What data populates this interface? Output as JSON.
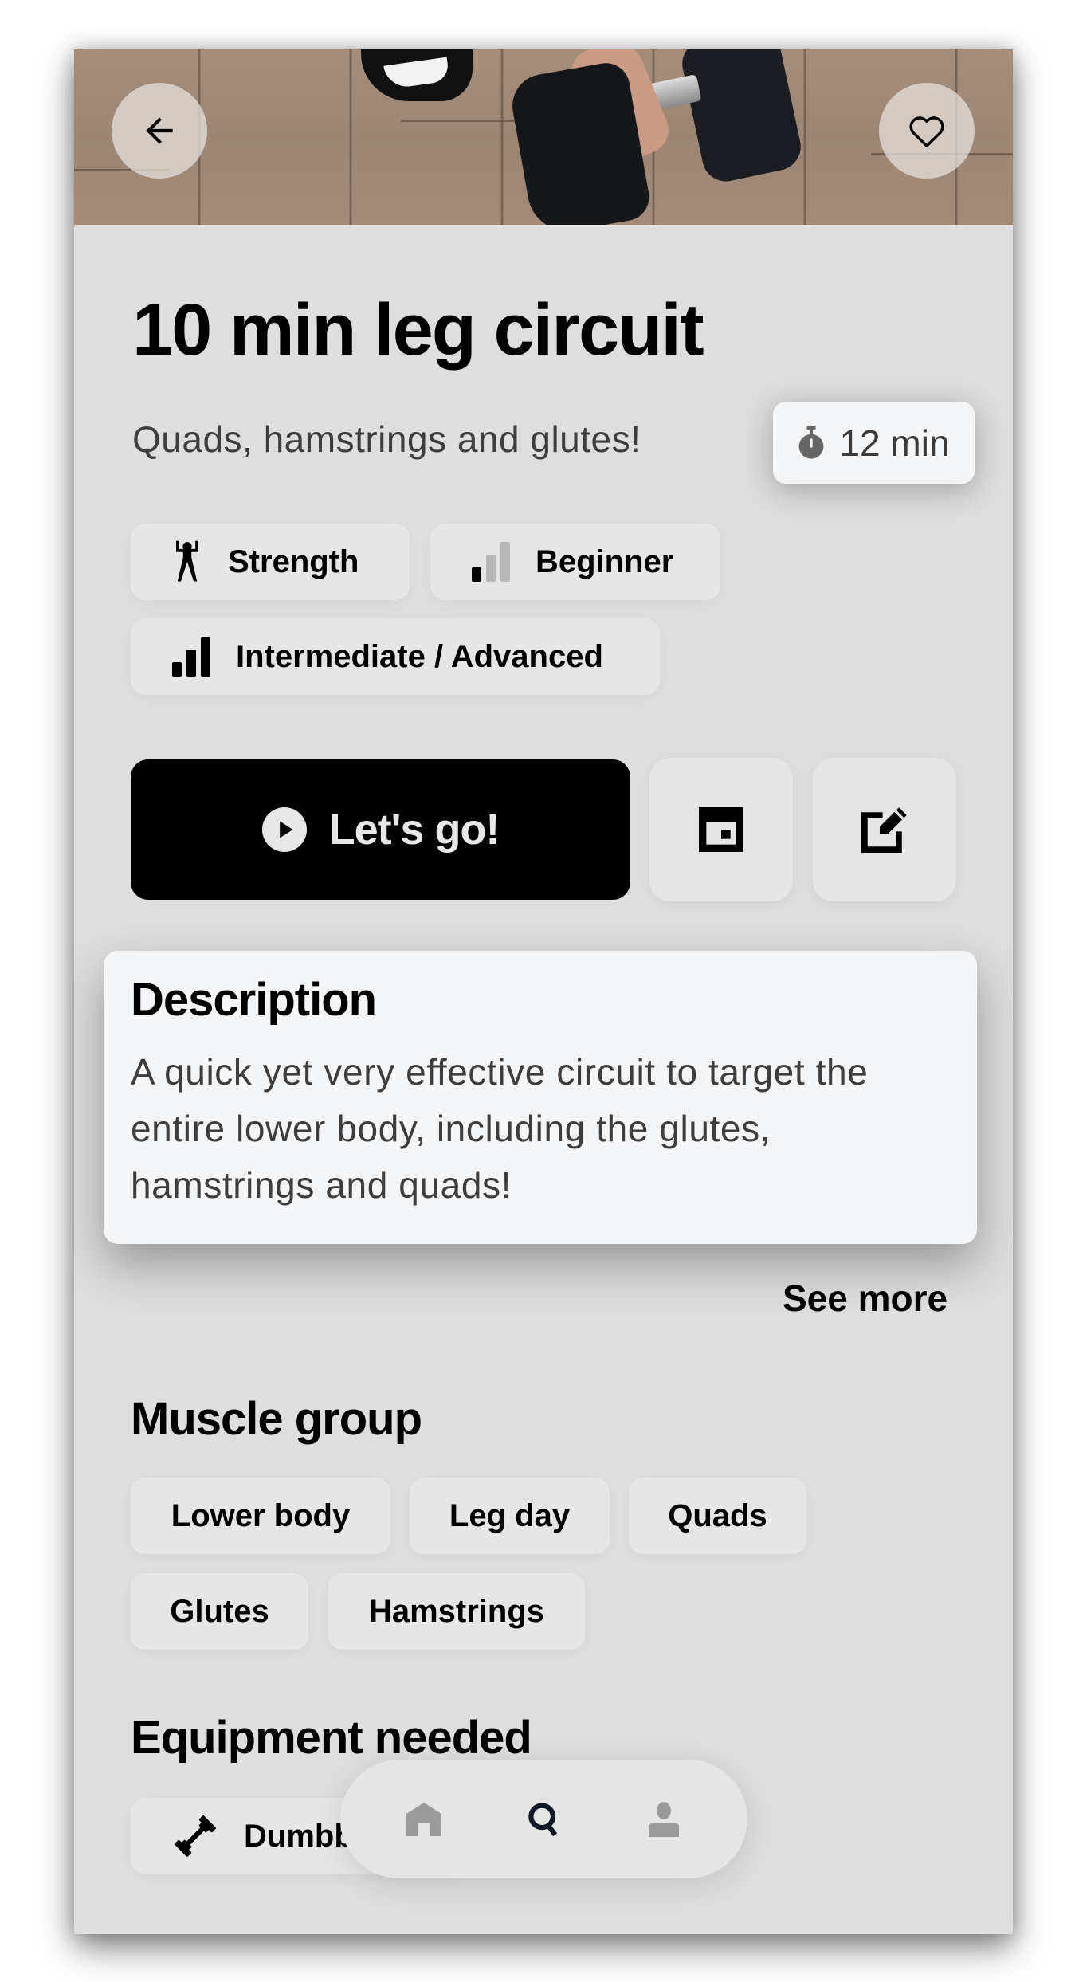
{
  "workout": {
    "title": "10 min leg circuit",
    "subtitle": "Quads, hamstrings and glutes!",
    "duration": "12 min"
  },
  "hero": {
    "back_icon": "arrow-left-icon",
    "favorite_icon": "heart-outline-icon",
    "image_alt": "Hand gripping a dumbbell on a wooden floor"
  },
  "tags": [
    {
      "label": "Strength",
      "icon": "strength-figure-icon"
    },
    {
      "label": "Beginner",
      "icon": "signal-bars-low-icon",
      "level": "1 of 3"
    },
    {
      "label": "Intermediate / Advanced",
      "icon": "signal-bars-full-icon",
      "level": "3 of 3"
    }
  ],
  "actions": {
    "start_label": "Let's go!",
    "start_icon": "play-circle-icon",
    "schedule_icon": "calendar-event-icon",
    "edit_icon": "edit-icon"
  },
  "description": {
    "heading": "Description",
    "text": "A quick yet very effective circuit to target the entire lower body, including the glutes, hamstrings and quads!",
    "see_more_label": "See more"
  },
  "muscle_group": {
    "heading": "Muscle group",
    "items": [
      "Lower body",
      "Leg day",
      "Quads",
      "Glutes",
      "Hamstrings"
    ]
  },
  "equipment": {
    "heading": "Equipment needed",
    "items": [
      {
        "label": "Dumbbells",
        "icon": "dumbbell-icon"
      }
    ]
  },
  "nav": {
    "items": [
      {
        "name": "home",
        "icon": "home-icon",
        "active": false
      },
      {
        "name": "search",
        "icon": "search-icon",
        "active": true
      },
      {
        "name": "profile",
        "icon": "profile-icon",
        "active": false
      }
    ],
    "active_color": "#111827",
    "inactive_color": "#9a9a9a"
  }
}
